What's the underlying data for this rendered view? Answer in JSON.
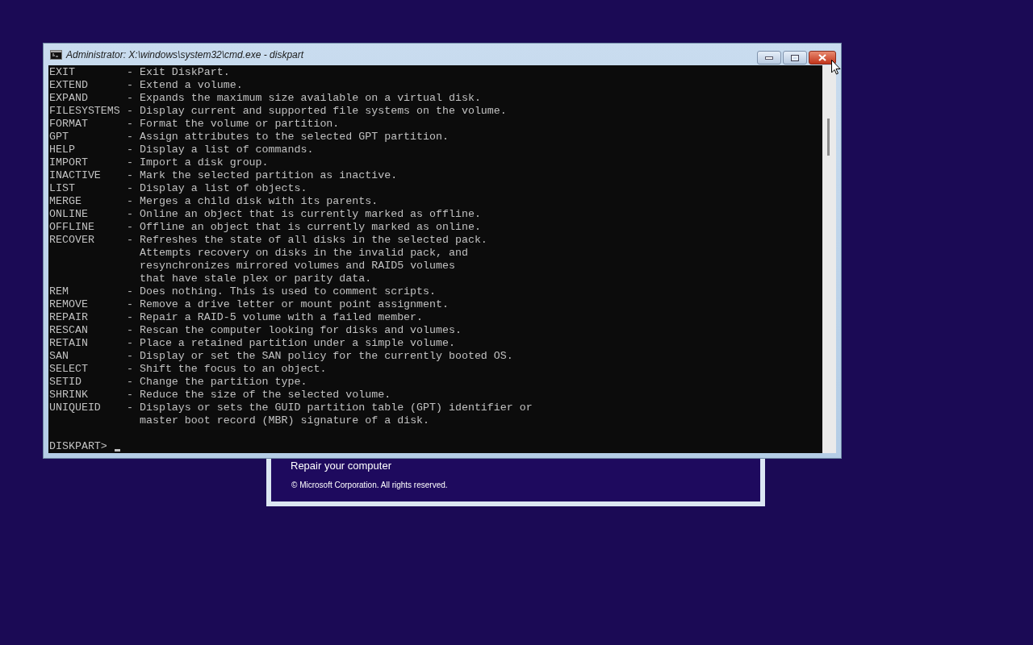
{
  "background_window": {
    "link": "Repair your computer",
    "copyright": "© Microsoft Corporation. All rights reserved."
  },
  "console": {
    "title": "Administrator: X:\\windows\\system32\\cmd.exe - diskpart",
    "lines": [
      {
        "command": "EXIT",
        "text": "- Exit DiskPart."
      },
      {
        "command": "EXTEND",
        "text": "- Extend a volume."
      },
      {
        "command": "EXPAND",
        "text": "- Expands the maximum size available on a virtual disk."
      },
      {
        "command": "FILESYSTEMS",
        "text": "- Display current and supported file systems on the volume."
      },
      {
        "command": "FORMAT",
        "text": "- Format the volume or partition."
      },
      {
        "command": "GPT",
        "text": "- Assign attributes to the selected GPT partition."
      },
      {
        "command": "HELP",
        "text": "- Display a list of commands."
      },
      {
        "command": "IMPORT",
        "text": "- Import a disk group."
      },
      {
        "command": "INACTIVE",
        "text": "- Mark the selected partition as inactive."
      },
      {
        "command": "LIST",
        "text": "- Display a list of objects."
      },
      {
        "command": "MERGE",
        "text": "- Merges a child disk with its parents."
      },
      {
        "command": "ONLINE",
        "text": "- Online an object that is currently marked as offline."
      },
      {
        "command": "OFFLINE",
        "text": "- Offline an object that is currently marked as online."
      },
      {
        "command": "RECOVER",
        "text": "- Refreshes the state of all disks in the selected pack."
      },
      {
        "text": "Attempts recovery on disks in the invalid pack, and"
      },
      {
        "text": "resynchronizes mirrored volumes and RAID5 volumes"
      },
      {
        "text": "that have stale plex or parity data."
      },
      {
        "command": "REM",
        "text": "- Does nothing. This is used to comment scripts."
      },
      {
        "command": "REMOVE",
        "text": "- Remove a drive letter or mount point assignment."
      },
      {
        "command": "REPAIR",
        "text": "- Repair a RAID-5 volume with a failed member."
      },
      {
        "command": "RESCAN",
        "text": "- Rescan the computer looking for disks and volumes."
      },
      {
        "command": "RETAIN",
        "text": "- Place a retained partition under a simple volume."
      },
      {
        "command": "SAN",
        "text": "- Display or set the SAN policy for the currently booted OS."
      },
      {
        "command": "SELECT",
        "text": "- Shift the focus to an object."
      },
      {
        "command": "SETID",
        "text": "- Change the partition type."
      },
      {
        "command": "SHRINK",
        "text": "- Reduce the size of the selected volume."
      },
      {
        "command": "UNIQUEID",
        "text": "- Displays or sets the GUID partition table (GPT) identifier or"
      },
      {
        "text": "master boot record (MBR) signature of a disk."
      }
    ],
    "prompt": "DISKPART>"
  }
}
